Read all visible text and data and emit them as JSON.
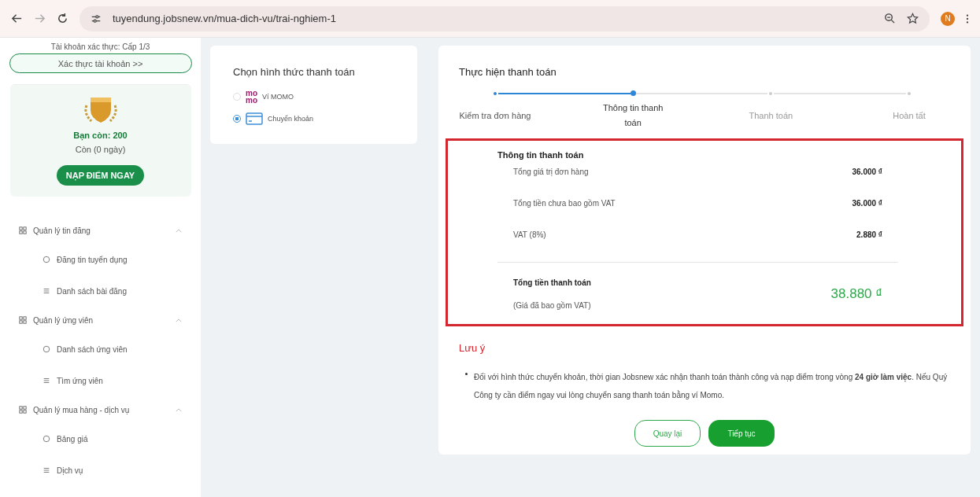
{
  "browser": {
    "url": "tuyendung.jobsnew.vn/mua-dich-vu/trai-nghiem-1",
    "avatar": "N"
  },
  "sidebar": {
    "verify_level": "Tài khoản xác thực: Cấp 1/3",
    "verify_button": "Xác thực tài khoản >>",
    "balance": "Bạn còn: 200",
    "days": "Còn (0 ngày)",
    "topup_button": "NẠP ĐIỂM NGAY",
    "menu": [
      {
        "label": "Quản lý tin đăng",
        "expanded": true,
        "children": [
          {
            "label": "Đăng tin tuyển dụng"
          },
          {
            "label": "Danh sách bài đăng"
          }
        ]
      },
      {
        "label": "Quản lý ứng viên",
        "expanded": true,
        "children": [
          {
            "label": "Danh sách ứng viên"
          },
          {
            "label": "Tìm ứng viên"
          }
        ]
      },
      {
        "label": "Quản lý mua hàng - dịch vụ",
        "expanded": true,
        "children": [
          {
            "label": "Bảng giá"
          },
          {
            "label": "Dịch vụ"
          }
        ]
      }
    ]
  },
  "payment_method": {
    "title": "Chọn hình thức thanh toán",
    "options": [
      {
        "kind": "momo",
        "logo": [
          "mo",
          "mo"
        ],
        "label": "Ví MOMO",
        "selected": false
      },
      {
        "kind": "bank",
        "label": "Chuyển khoản",
        "selected": true
      }
    ]
  },
  "checkout": {
    "title": "Thực hiện thanh toán",
    "steps": [
      {
        "label": "Kiểm tra đơn hàng",
        "completed": true,
        "selected": false
      },
      {
        "label": "Thông tin thanh toán",
        "completed": false,
        "selected": true
      },
      {
        "label": "Thanh toán",
        "completed": false,
        "selected": false
      },
      {
        "label": "Hoàn tất",
        "completed": false,
        "selected": false
      }
    ],
    "summary": {
      "title": "Thông tin thanh toán",
      "rows": [
        {
          "label": "Tổng giá trị đơn hàng",
          "value": "36.000 ₫"
        },
        {
          "label": "Tổng tiền chưa bao gồm VAT",
          "value": "36.000 ₫"
        },
        {
          "label": "VAT (8%)",
          "value": "2.880 ₫"
        }
      ],
      "total_label": "Tổng tiền thanh toán",
      "total_note": "(Giá đã bao gồm VAT)",
      "total_value": "38.880 ₫"
    },
    "note_title": "Lưu ý",
    "notes": [
      "Đối với hình thức chuyển khoản, thời gian Jobsnew xác nhận thanh toán thành công và nạp điểm trong vòng **24 giờ làm việc**. Nếu Quý Công ty cần điểm ngay vui lòng chuyển sang thanh toán bằng ví Momo."
    ],
    "back_button": "Quay lại",
    "next_button": "Tiếp tục"
  }
}
